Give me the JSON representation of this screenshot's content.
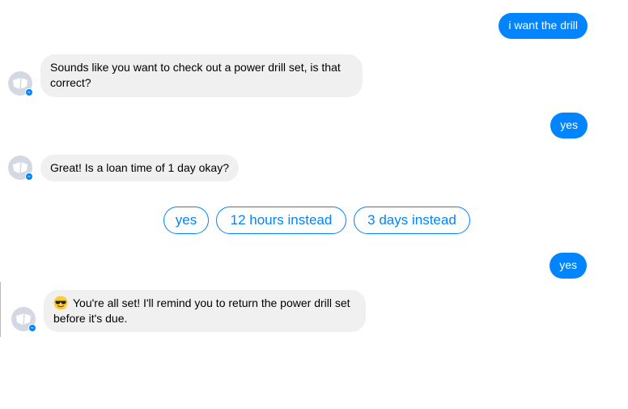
{
  "conversation": {
    "messages": [
      {
        "from": "user",
        "text": "i want the drill"
      },
      {
        "from": "bot",
        "text": "Sounds like you want to check out a power drill set, is that correct?"
      },
      {
        "from": "user",
        "text": "yes"
      },
      {
        "from": "bot",
        "text": "Great! Is a loan time of 1 day okay?"
      },
      {
        "from": "user",
        "text": "yes"
      },
      {
        "from": "bot",
        "emoji": "sunglasses-face",
        "text": "You're all set!  I'll remind you to return the power drill set before it's due."
      }
    ],
    "quick_replies": [
      "yes",
      "12 hours instead",
      "3 days instead"
    ]
  },
  "colors": {
    "accent": "#0084ff",
    "incoming_bubble": "#f1f0f0",
    "avatar_bg": "#d3d8e2",
    "messenger_badge": "#0084ff"
  },
  "icons": {
    "avatar": "bot-avatar-icon",
    "badge": "messenger-badge-icon"
  }
}
